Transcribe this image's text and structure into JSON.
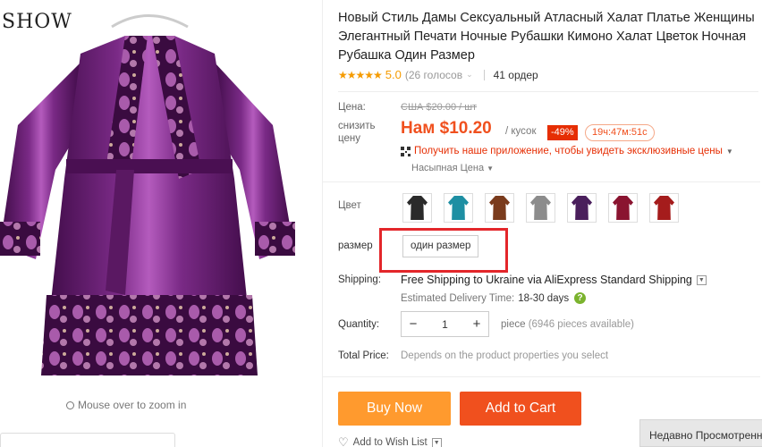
{
  "gallery": {
    "brand_text": "SHOW",
    "watermark": "XUSHOW",
    "zoom_hint": "Mouse over to zoom in"
  },
  "product": {
    "title": "Новый Стиль Дамы Сексуальный Атласный Халат Платье Женщины Элегантный Печати Ночные Рубашки Кимоно Халат Цветок Ночная Рубашка Один Размер",
    "rating": {
      "stars": "★★★★★",
      "score": "5.0",
      "votes": "(26 голосов",
      "votes_chevron": "⌄",
      "orders": "41 ордер"
    }
  },
  "price": {
    "label": "Цена:",
    "old_price": "США $20.00 / шт",
    "discount_label": "снизить цену",
    "new_price": "Нам $10.20",
    "unit": "/ кусок",
    "discount": "-49%",
    "countdown": "19ч:47м:51с",
    "app_promo": "Получить наше приложение, чтобы увидеть эксклюзивные цены",
    "bulk_price": "Насыпная Цена"
  },
  "options": {
    "color_label": "Цвет",
    "colors": [
      {
        "name": "black",
        "hex": "#2a2a2a"
      },
      {
        "name": "teal",
        "hex": "#1e8fa3"
      },
      {
        "name": "brown",
        "hex": "#7a3b1c"
      },
      {
        "name": "grey",
        "hex": "#8c8c8c"
      },
      {
        "name": "purple",
        "hex": "#4a1f5c"
      },
      {
        "name": "wine",
        "hex": "#8a1430"
      },
      {
        "name": "red",
        "hex": "#a51c1c"
      }
    ],
    "size_label": "размер",
    "size_value": "один размер"
  },
  "shipping": {
    "label": "Shipping:",
    "method": "Free Shipping to Ukraine via AliExpress Standard Shipping",
    "estimate_label": "Estimated Delivery Time:",
    "estimate_days": "18-30 days",
    "help": "?"
  },
  "quantity": {
    "label": "Quantity:",
    "value": "1",
    "minus": "−",
    "plus": "+",
    "available_unit": "piece",
    "available": "(6946 pieces available)"
  },
  "total": {
    "label": "Total Price:",
    "note": "Depends on the product properties you select"
  },
  "actions": {
    "buy_now": "Buy Now",
    "add_to_cart": "Add to Cart",
    "wishlist": "Add to Wish List",
    "wishlist_chevron": "⌄"
  },
  "recently_viewed": "Недавно Просмотренные",
  "colors": {
    "accent_orange": "#f0501e",
    "buy_now": "#ff9a2e",
    "highlight_red": "#e3262a",
    "robe_purple": "#5a1460"
  }
}
